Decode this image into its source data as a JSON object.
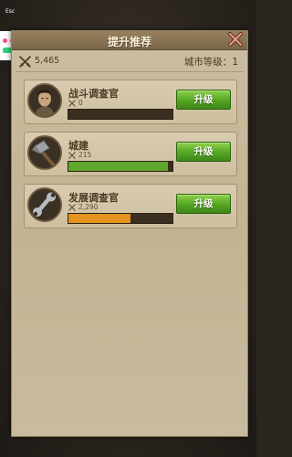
{
  "system": {
    "esc_label": "Esc"
  },
  "panel": {
    "title": "提升推荐",
    "power_value": "5,465",
    "city_level_label": "城市等级：",
    "city_level_value": "1",
    "upgrade_label": "升级"
  },
  "cards": [
    {
      "name": "战斗调查官",
      "value": "0",
      "progress": 0.0,
      "bar_color": "#5fa82b",
      "icon": "officer-portrait-icon"
    },
    {
      "name": "城建",
      "value": "215",
      "progress": 0.96,
      "bar_color": "#5fa82b",
      "icon": "hammer-icon"
    },
    {
      "name": "发展调查官",
      "value": "2,290",
      "progress": 0.6,
      "bar_color": "#e3931e",
      "icon": "wrench-icon"
    }
  ],
  "colors": {
    "green_bar": "#5fa82b",
    "orange_bar": "#e3931e",
    "upgrade_button": "#54a623",
    "close_x": "#d98c7a"
  }
}
